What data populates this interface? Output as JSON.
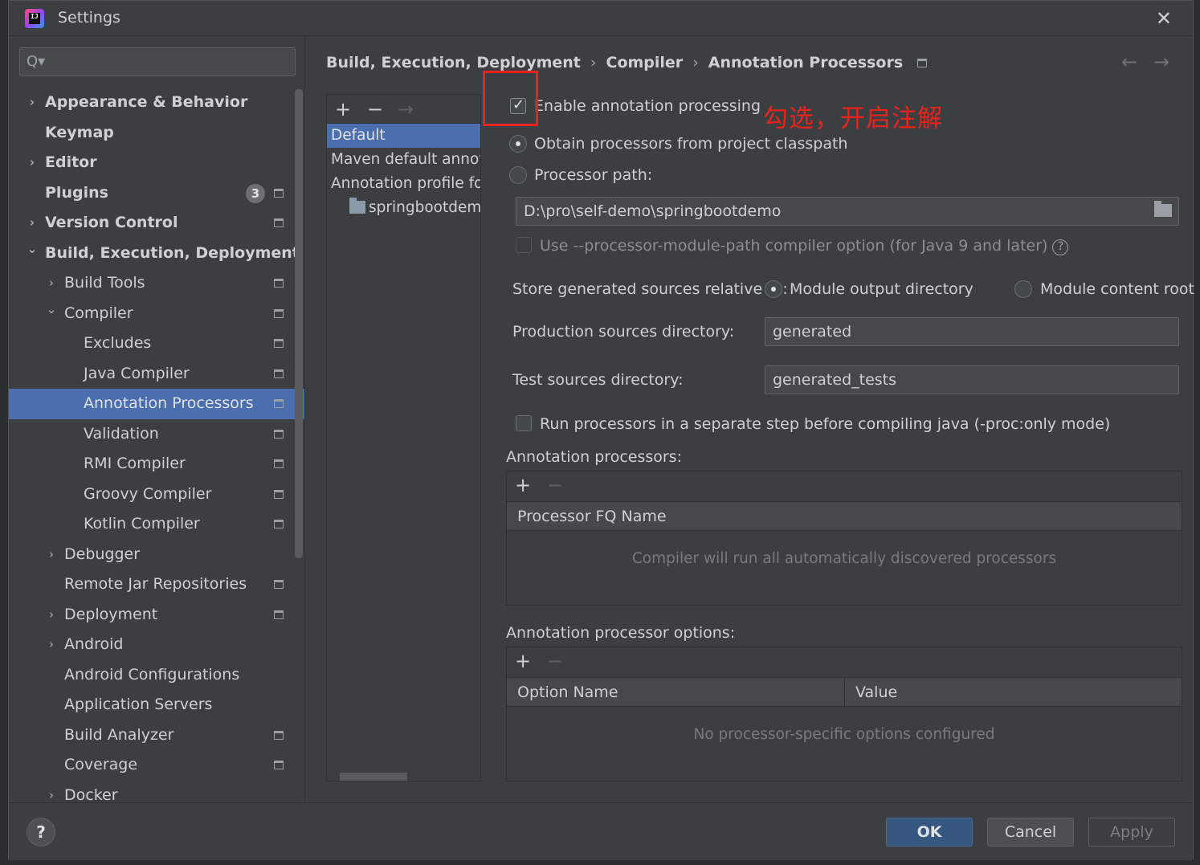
{
  "window": {
    "title": "Settings",
    "close_glyph": "✕"
  },
  "search": {
    "placeholder": "",
    "icon": "Q▾"
  },
  "sidebar": {
    "items": [
      {
        "label": "Appearance & Behavior",
        "level": 0,
        "chevron": "›",
        "bold": true,
        "proj": false
      },
      {
        "label": "Keymap",
        "level": 0,
        "chevron": "",
        "bold": true,
        "proj": false
      },
      {
        "label": "Editor",
        "level": 0,
        "chevron": "›",
        "bold": true,
        "proj": false
      },
      {
        "label": "Plugins",
        "level": 0,
        "chevron": "",
        "bold": true,
        "proj": true,
        "badge": "3"
      },
      {
        "label": "Version Control",
        "level": 0,
        "chevron": "›",
        "bold": true,
        "proj": true
      },
      {
        "label": "Build, Execution, Deployment",
        "level": 0,
        "chevron": "⌄",
        "bold": true,
        "proj": false
      },
      {
        "label": "Build Tools",
        "level": 1,
        "chevron": "›",
        "bold": false,
        "proj": true
      },
      {
        "label": "Compiler",
        "level": 1,
        "chevron": "⌄",
        "bold": false,
        "proj": true
      },
      {
        "label": "Excludes",
        "level": 2,
        "chevron": "",
        "bold": false,
        "proj": true
      },
      {
        "label": "Java Compiler",
        "level": 2,
        "chevron": "",
        "bold": false,
        "proj": true
      },
      {
        "label": "Annotation Processors",
        "level": 2,
        "chevron": "",
        "bold": false,
        "proj": true,
        "selected": true
      },
      {
        "label": "Validation",
        "level": 2,
        "chevron": "",
        "bold": false,
        "proj": true
      },
      {
        "label": "RMI Compiler",
        "level": 2,
        "chevron": "",
        "bold": false,
        "proj": true
      },
      {
        "label": "Groovy Compiler",
        "level": 2,
        "chevron": "",
        "bold": false,
        "proj": true
      },
      {
        "label": "Kotlin Compiler",
        "level": 2,
        "chevron": "",
        "bold": false,
        "proj": true
      },
      {
        "label": "Debugger",
        "level": 1,
        "chevron": "›",
        "bold": false,
        "proj": false
      },
      {
        "label": "Remote Jar Repositories",
        "level": 1,
        "chevron": "",
        "bold": false,
        "proj": true
      },
      {
        "label": "Deployment",
        "level": 1,
        "chevron": "›",
        "bold": false,
        "proj": true
      },
      {
        "label": "Android",
        "level": 1,
        "chevron": "›",
        "bold": false,
        "proj": false
      },
      {
        "label": "Android Configurations",
        "level": 1,
        "chevron": "",
        "bold": false,
        "proj": false
      },
      {
        "label": "Application Servers",
        "level": 1,
        "chevron": "",
        "bold": false,
        "proj": false
      },
      {
        "label": "Build Analyzer",
        "level": 1,
        "chevron": "",
        "bold": false,
        "proj": true
      },
      {
        "label": "Coverage",
        "level": 1,
        "chevron": "",
        "bold": false,
        "proj": true
      },
      {
        "label": "Docker",
        "level": 1,
        "chevron": "›",
        "bold": false,
        "proj": false
      }
    ]
  },
  "breadcrumb": {
    "part1": "Build, Execution, Deployment",
    "part2": "Compiler",
    "part3": "Annotation Processors",
    "sep": "›"
  },
  "nav": {
    "back": "←",
    "forward": "→"
  },
  "profiles": {
    "toolbar": {
      "add": "+",
      "remove": "−",
      "move": "→"
    },
    "items": [
      "Default",
      "Maven default annotation processors profile",
      "Annotation profile for springbootdemo"
    ],
    "module": "springbootdemo"
  },
  "form": {
    "enable_label": "Enable annotation processing",
    "enable_checked": true,
    "obtain_label": "Obtain processors from project classpath",
    "processor_path_label": "Processor path:",
    "processor_path_value": "D:\\pro\\self-demo\\springbootdemo",
    "module_path_label": "Use --processor-module-path compiler option (for Java 9 and later)",
    "help_glyph": "?",
    "store_label": "Store generated sources relative to:",
    "store_opt1": "Module output directory",
    "store_opt2": "Module content root",
    "prod_label": "Production sources directory:",
    "prod_value": "generated",
    "test_label": "Test sources directory:",
    "test_value": "generated_tests",
    "run_sep_label": "Run processors in a separate step before compiling java (-proc:only mode)"
  },
  "processors_table": {
    "title": "Annotation processors:",
    "add": "+",
    "remove": "−",
    "column": "Processor FQ Name",
    "empty": "Compiler will run all automatically discovered processors"
  },
  "options_table": {
    "title": "Annotation processor options:",
    "add": "+",
    "remove": "−",
    "col1": "Option Name",
    "col2": "Value",
    "empty": "No processor-specific options configured"
  },
  "annotation": {
    "note": "勾选，开启注解",
    "color": "#e8231d"
  },
  "footer": {
    "help": "?",
    "ok": "OK",
    "cancel": "Cancel",
    "apply": "Apply"
  }
}
